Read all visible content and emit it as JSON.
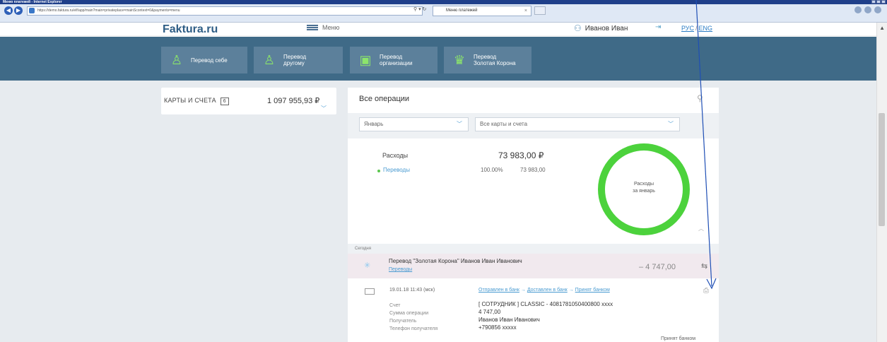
{
  "browser": {
    "window_title": "Меню платежей - Internet Explorer",
    "url": "https://demo.faktura.ru/elf/app/main?main=privateplace=mainScontext=0&payments=menu",
    "tab_title": "Меню платежей"
  },
  "header": {
    "logo": "Faktura.ru",
    "menu_label": "Меню",
    "user_name": "Иванов Иван",
    "lang_ru": "РУС",
    "lang_sep": "/",
    "lang_en": "ENG"
  },
  "actions": [
    {
      "label": "Перевод себе",
      "icon": "person-icon"
    },
    {
      "label": "Перевод другому",
      "icon": "persons-icon"
    },
    {
      "label": "Перевод организации",
      "icon": "briefcase-icon"
    },
    {
      "label": "Перевод Золотая Корона",
      "icon": "crown-icon"
    }
  ],
  "cards": {
    "title": "КАРТЫ И СЧЕТА",
    "count": "6",
    "amount": "1 097 955,93 ₽"
  },
  "operations": {
    "title": "Все операции",
    "filter_month": "Январь",
    "filter_accounts": "Все карты и счета",
    "expenses_label": "Расходы",
    "expenses_amount": "73 983,00 ₽",
    "category": "Переводы",
    "category_pct": "100.00%",
    "category_amount": "73 983,00",
    "donut_line1": "Расходы",
    "donut_line2": "за январь"
  },
  "chart_data": {
    "type": "pie",
    "categories": [
      "Переводы"
    ],
    "values": [
      100
    ],
    "colors": [
      "#4cd23c"
    ]
  },
  "today": {
    "label": "Сегодня",
    "tx_title": "Перевод \"Золотая Корона\" Иванов Иван Иванович",
    "tx_category": "Переводы",
    "tx_amount": "– 4 747,00",
    "time": "19.01.18 11:43 (мск)",
    "status1": "Отправлен в банк",
    "status2": "Доставлен в банк",
    "status3": "Принят банком",
    "arrow": "→",
    "labels": [
      "Счет",
      "Сумма операции",
      "Получатель",
      "Телефон получателя"
    ],
    "values": [
      "[ СОТРУДНИК ] CLASSIC - 4081781050400800 xxxx",
      "4 747,00",
      "Иванов Иван Иванович",
      "+790856 xxxxx"
    ],
    "footer": "Принят банком"
  }
}
